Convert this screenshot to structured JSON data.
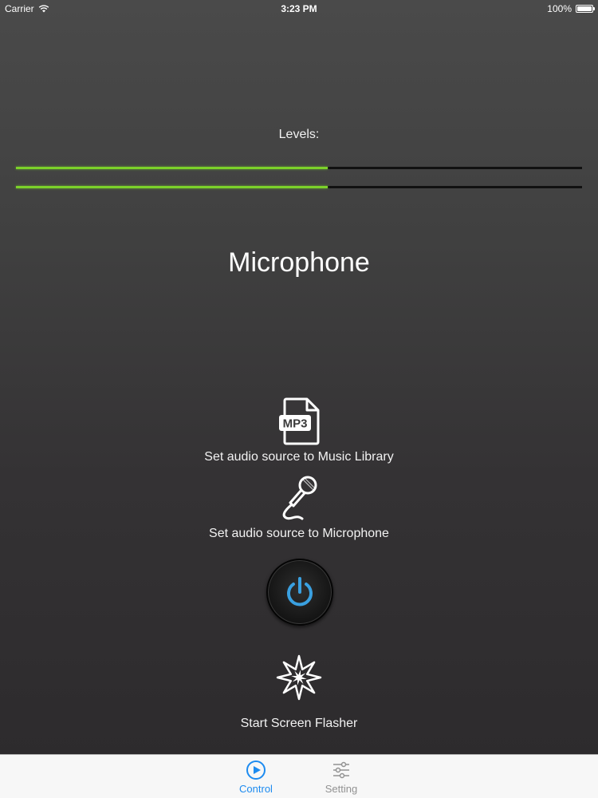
{
  "status_bar": {
    "carrier": "Carrier",
    "time": "3:23 PM",
    "battery": "100%"
  },
  "levels": {
    "label": "Levels:",
    "channels": [
      0.55,
      0.55
    ],
    "color": "#7cd12a"
  },
  "source": {
    "current": "Microphone"
  },
  "actions": {
    "music_library": {
      "label": "Set audio source to Music Library",
      "icon": "mp3-file-icon"
    },
    "microphone": {
      "label": "Set audio source to Microphone",
      "icon": "microphone-icon"
    },
    "power": {
      "icon": "power-icon",
      "color": "#3aa0e0"
    },
    "flasher": {
      "label": "Start Screen Flasher",
      "icon": "starburst-icon"
    }
  },
  "tab_bar": {
    "tabs": [
      {
        "label": "Control",
        "icon": "play-circle-icon",
        "active": true
      },
      {
        "label": "Setting",
        "icon": "sliders-icon",
        "active": false
      }
    ],
    "active_color": "#1d8bf0",
    "inactive_color": "#929292"
  }
}
